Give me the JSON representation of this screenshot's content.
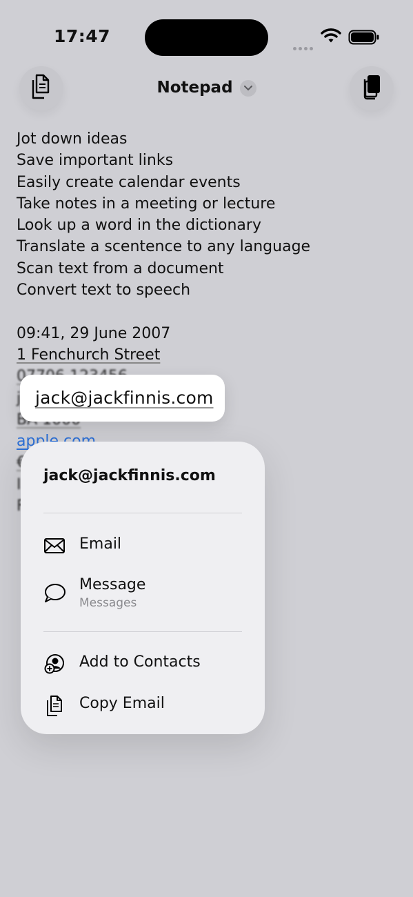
{
  "status_bar": {
    "time": "17:47",
    "icons": [
      "cellular-dots-icon",
      "wifi-icon",
      "battery-icon"
    ]
  },
  "nav": {
    "title": "Notepad",
    "left_icon": "documents-icon",
    "right_icon": "copy-to-device-icon",
    "title_icon": "chevron-down-icon"
  },
  "note": {
    "lines": [
      "Jot down ideas",
      "Save important links",
      "Easily create calendar events",
      "Take notes in a meeting or lecture",
      "Look up a word in the dictionary",
      "Translate a scentence to any language",
      "Scan text from a document",
      "Convert text to speech",
      "",
      "09:41, 29 June 2007",
      "1 Fenchurch Street",
      "07706 123456",
      "j",
      "BA 1000",
      "apple.com",
      "€",
      "I",
      "F"
    ]
  },
  "preview": {
    "email": "jack@jackfinnis.com"
  },
  "menu": {
    "header": "jack@jackfinnis.com",
    "items": [
      {
        "label": "Email",
        "icon": "envelope-icon"
      },
      {
        "label": "Message",
        "sublabel": "Messages",
        "icon": "message-bubble-icon"
      },
      {
        "label": "Add to Contacts",
        "icon": "add-contact-icon"
      },
      {
        "label": "Copy Email",
        "icon": "copy-icon"
      }
    ]
  },
  "colors": {
    "background": "#cfcfd4",
    "menu": "#efeff2",
    "link": "#2b6fd6"
  }
}
